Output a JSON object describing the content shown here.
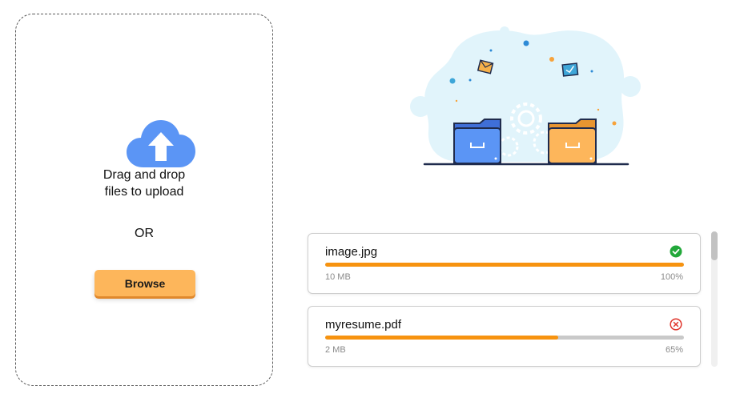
{
  "upload": {
    "drag_text_line1": "Drag and drop",
    "drag_text_line2": "files to upload",
    "or_text": "OR",
    "browse_label": "Browse",
    "accent_color": "#fdb65b"
  },
  "files": [
    {
      "name": "image.jpg",
      "size": "10 MB",
      "percent": "100%",
      "progress": 1.0,
      "status": "success",
      "status_icon": "check-circle-icon",
      "status_color": "#22a83a"
    },
    {
      "name": "myresume.pdf",
      "size": "2 MB",
      "percent": "65%",
      "progress": 0.65,
      "status": "error",
      "status_icon": "x-circle-icon",
      "status_color": "#e0362c"
    }
  ],
  "colors": {
    "progress_fill": "#f7930f",
    "progress_track": "#c9c9c9",
    "cloud": "#5b95f5"
  }
}
